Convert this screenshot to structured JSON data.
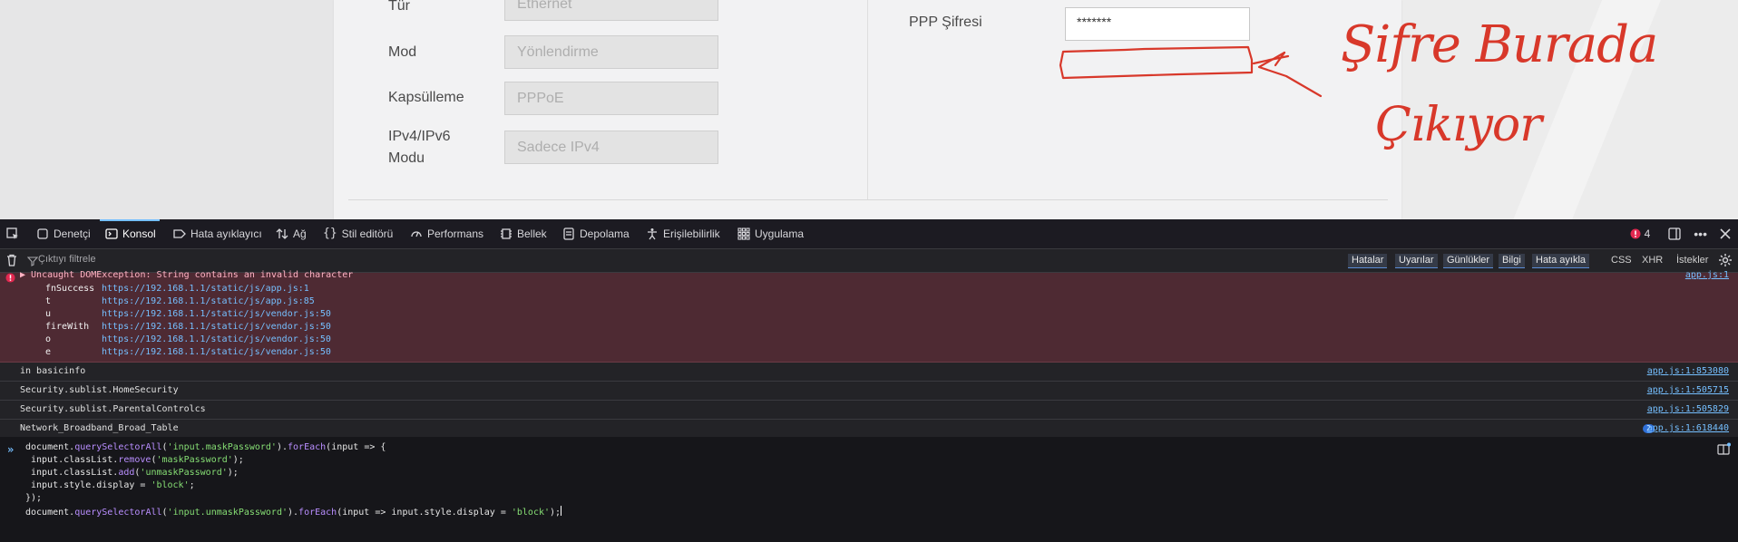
{
  "page": {
    "rows": [
      {
        "label": "Tür",
        "value": "Ethernet"
      },
      {
        "label": "Mod",
        "value": "Yönlendirme"
      },
      {
        "label": "Kapsülleme",
        "value": "PPPoE"
      },
      {
        "label": "IPv4/IPv6\nModu",
        "value": "Sadece IPv4"
      }
    ],
    "ppp_label": "PPP Şifresi",
    "ppp_value": "*******",
    "annotation": "Şifre Burada Çıkıyor",
    "annotation_color": "#d8382a"
  },
  "devtools": {
    "tabs": [
      {
        "label": "Denetçi",
        "icon": "inspector-icon"
      },
      {
        "label": "Konsol",
        "icon": "console-icon",
        "active": true
      },
      {
        "label": "Hata ayıklayıcı",
        "icon": "debugger-icon"
      },
      {
        "label": "Ağ",
        "icon": "network-icon"
      },
      {
        "label": "Stil editörü",
        "icon": "style-editor-icon"
      },
      {
        "label": "Performans",
        "icon": "performance-icon"
      },
      {
        "label": "Bellek",
        "icon": "memory-icon"
      },
      {
        "label": "Depolama",
        "icon": "storage-icon"
      },
      {
        "label": "Erişilebilirlik",
        "icon": "accessibility-icon"
      },
      {
        "label": "Uygulama",
        "icon": "application-icon"
      }
    ],
    "error_count": "4",
    "filter_placeholder": "Çıktıyı filtrele",
    "levels": [
      "Hatalar",
      "Uyarılar",
      "Günlükler",
      "Bilgi",
      "Hata ayıkla"
    ],
    "request_filters": [
      "CSS",
      "XHR",
      "İstekler"
    ],
    "error": {
      "message": "▶ Uncaught DOMException: String contains an invalid character",
      "source": "app.js:1",
      "stack": [
        {
          "fn": "fnSuccess",
          "url": "https://192.168.1.1/static/js/app.js:1"
        },
        {
          "fn": "t",
          "url": "https://192.168.1.1/static/js/app.js:85"
        },
        {
          "fn": "u",
          "url": "https://192.168.1.1/static/js/vendor.js:50"
        },
        {
          "fn": "fireWith",
          "url": "https://192.168.1.1/static/js/vendor.js:50"
        },
        {
          "fn": "o",
          "url": "https://192.168.1.1/static/js/vendor.js:50"
        },
        {
          "fn": "e",
          "url": "https://192.168.1.1/static/js/vendor.js:50"
        }
      ]
    },
    "messages": [
      {
        "text": "in basicinfo",
        "source": "app.js:1:853080"
      },
      {
        "text": "Security.sublist.HomeSecurity",
        "source": "app.js:1:505715"
      },
      {
        "text": "Security.sublist.ParentalControlcs",
        "source": "app.js:1:505829"
      },
      {
        "text": "Network_Broadband_Broad_Table",
        "source": "app.js:1:618440",
        "count": "2"
      }
    ],
    "code": {
      "line1_a": "document.",
      "line1_b": "querySelectorAll",
      "line1_c": "(",
      "line1_s": "'input.maskPassword'",
      "line1_d": ").",
      "line1_e": "forEach",
      "line1_f": "(input => {",
      "line2_a": "input.classList.",
      "line2_b": "remove",
      "line2_c": "(",
      "line2_s": "'maskPassword'",
      "line2_d": ");",
      "line3_a": "input.classList.",
      "line3_b": "add",
      "line3_c": "(",
      "line3_s": "'unmaskPassword'",
      "line3_d": ");",
      "line4_a": "input.style.display = ",
      "line4_s": "'block'",
      "line4_d": ";",
      "line5": "});",
      "line6_a": "document.",
      "line6_b": "querySelectorAll",
      "line6_c": "(",
      "line6_s": "'input.unmaskPassword'",
      "line6_d": ").",
      "line6_e": "forEach",
      "line6_f": "(input => input.style.display = ",
      "line6_s2": "'block'",
      "line6_g": ");"
    }
  }
}
